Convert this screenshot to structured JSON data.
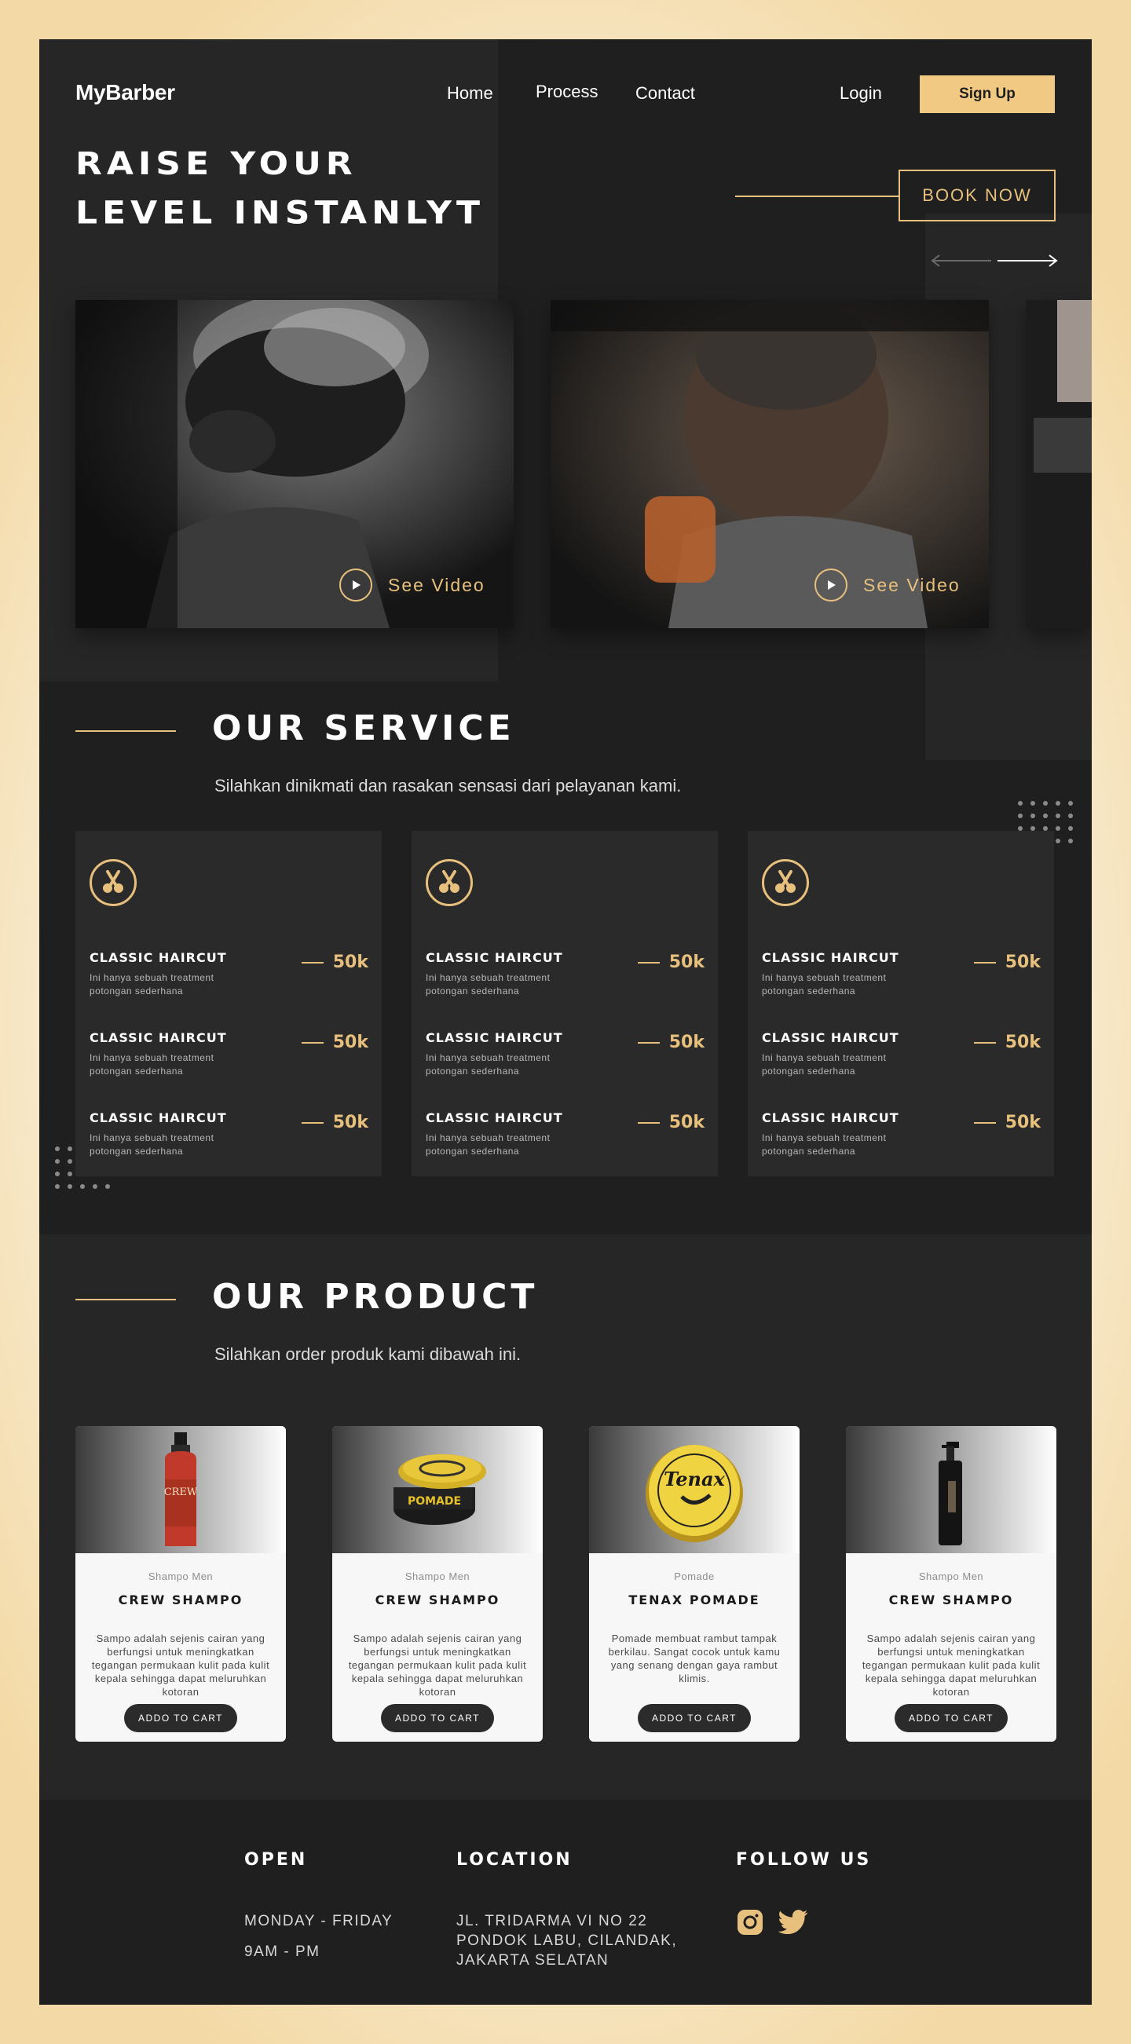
{
  "brand": "MyBarber",
  "nav": {
    "items": [
      "Home",
      "Process",
      "Contact"
    ],
    "login": "Login",
    "signup": "Sign Up"
  },
  "hero": {
    "title_line1": "RAISE YOUR",
    "title_line2": "LEVEL INSTANLYT",
    "book_now": "BOOK NOW"
  },
  "slides": [
    {
      "video_label": "See Video"
    },
    {
      "video_label": "See Video"
    }
  ],
  "service": {
    "title": "OUR SERVICE",
    "subtitle": "Silahkan dinikmati dan rasakan sensasi dari pelayanan kami.",
    "cards": [
      {
        "items": [
          {
            "name": "CLASSIC HAIRCUT",
            "desc": "Ini hanya sebuah treatment potongan sederhana",
            "price": "50k"
          },
          {
            "name": "CLASSIC HAIRCUT",
            "desc": "Ini hanya sebuah treatment potongan sederhana",
            "price": "50k"
          },
          {
            "name": "CLASSIC HAIRCUT",
            "desc": "Ini hanya sebuah treatment potongan sederhana",
            "price": "50k"
          }
        ]
      },
      {
        "items": [
          {
            "name": "CLASSIC HAIRCUT",
            "desc": "Ini hanya sebuah treatment potongan sederhana",
            "price": "50k"
          },
          {
            "name": "CLASSIC HAIRCUT",
            "desc": "Ini hanya sebuah treatment potongan sederhana",
            "price": "50k"
          },
          {
            "name": "CLASSIC HAIRCUT",
            "desc": "Ini hanya sebuah treatment potongan sederhana",
            "price": "50k"
          }
        ]
      },
      {
        "items": [
          {
            "name": "CLASSIC HAIRCUT",
            "desc": "Ini hanya sebuah treatment potongan sederhana",
            "price": "50k"
          },
          {
            "name": "CLASSIC HAIRCUT",
            "desc": "Ini hanya sebuah treatment potongan sederhana",
            "price": "50k"
          },
          {
            "name": "CLASSIC HAIRCUT",
            "desc": "Ini hanya sebuah treatment potongan sederhana",
            "price": "50k"
          }
        ]
      }
    ]
  },
  "product": {
    "title": "OUR PRODUCT",
    "subtitle": "Silahkan order produk kami dibawah ini.",
    "items": [
      {
        "category": "Shampo Men",
        "name": "CREW SHAMPO",
        "desc": "Sampo adalah sejenis cairan yang berfungsi untuk meningkatkan tegangan permukaan kulit pada kulit kepala sehingga dapat meluruhkan kotoran",
        "button": "ADDO TO CART",
        "label_text": "CREW"
      },
      {
        "category": "Shampo Men",
        "name": "CREW SHAMPO",
        "desc": "Sampo adalah sejenis cairan yang berfungsi untuk meningkatkan tegangan permukaan kulit pada kulit kepala sehingga dapat meluruhkan kotoran",
        "button": "ADDO TO CART",
        "label_text": "POMADE"
      },
      {
        "category": "Pomade",
        "name": "TENAX POMADE",
        "desc": "Pomade membuat rambut tampak berkilau. Sangat cocok untuk kamu yang senang dengan gaya rambut klimis.",
        "button": "ADDO TO CART",
        "label_text": "Tenax"
      },
      {
        "category": "Shampo Men",
        "name": "CREW SHAMPO",
        "desc": "Sampo adalah sejenis cairan yang berfungsi untuk meningkatkan tegangan permukaan kulit pada kulit kepala sehingga dapat meluruhkan kotoran",
        "button": "ADDO TO CART"
      }
    ]
  },
  "footer": {
    "open_title": "OPEN",
    "open_days": "MONDAY - FRIDAY",
    "open_hours": "9AM - PM",
    "location_title": "LOCATION",
    "location_lines": [
      "JL. TRIDARMA VI NO 22",
      "PONDOK LABU, CILANDAK,",
      "JAKARTA SELATAN"
    ],
    "follow_title": "FOLLOW US",
    "social_icons": [
      "instagram-icon",
      "twitter-icon"
    ]
  },
  "colors": {
    "accent": "#e8c07d",
    "signup": "#f1c983",
    "dark": "#1f1f1f",
    "panel": "#262626",
    "card": "#2a2a2a"
  }
}
